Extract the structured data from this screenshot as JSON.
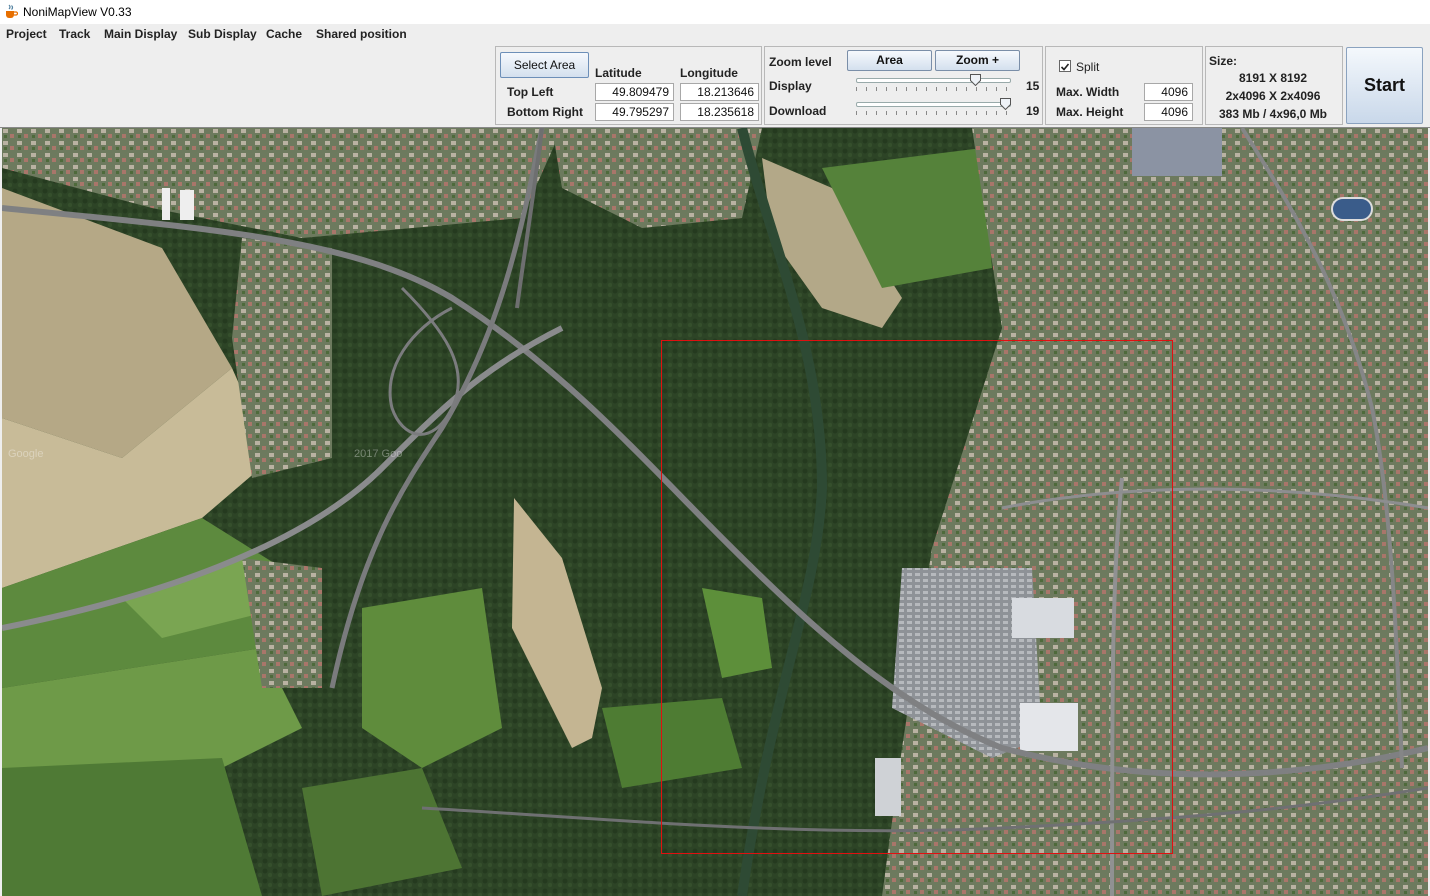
{
  "window": {
    "title": "NoniMapView V0.33",
    "icon": "java-cup-icon"
  },
  "menu": [
    "Project",
    "Track",
    "Main Display",
    "Sub Display",
    "Cache",
    "Shared position"
  ],
  "area_panel": {
    "select_button": "Select Area",
    "col_latitude": "Latitude",
    "col_longitude": "Longitude",
    "row_top_left": "Top Left",
    "row_bottom_right": "Bottom Right",
    "top_left_lat": "49.809479",
    "top_left_lon": "18.213646",
    "bottom_right_lat": "49.795297",
    "bottom_right_lon": "18.235618"
  },
  "zoom_panel": {
    "title": "Zoom level",
    "area_button": "Area",
    "zoom_plus_button": "Zoom +",
    "display_label": "Display",
    "display_value": "15",
    "display_fraction": 0.79,
    "download_label": "Download",
    "download_value": "19",
    "download_fraction": 1.0
  },
  "split_panel": {
    "split_label": "Split",
    "split_checked": true,
    "max_width_label": "Max. Width",
    "max_width_value": "4096",
    "max_height_label": "Max. Height",
    "max_height_value": "4096"
  },
  "size_panel": {
    "title": "Size:",
    "line1": "8191 X 8192",
    "line2": "2x4096 X 2x4096",
    "line3": "383 Mb / 4x96,0 Mb"
  },
  "start_button": "Start",
  "map": {
    "watermarks": [
      "Google",
      "2017 Goo"
    ],
    "selection_color": "#e01010"
  }
}
